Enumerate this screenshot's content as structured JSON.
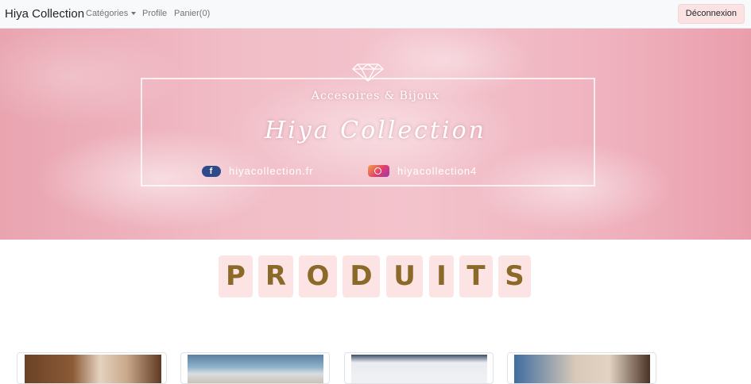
{
  "navbar": {
    "brand": "Hiya Collection",
    "categories_label": "Catégories",
    "profile_label": "Profile",
    "cart_label": "Panier(0)",
    "logout_label": "Déconnexion"
  },
  "banner": {
    "tagline": "Accesoires & Bijoux",
    "title": "Hiya Collection",
    "facebook_handle": "hiyacollection.fr",
    "instagram_handle": "hiyacollection4"
  },
  "produits": {
    "letters": [
      "P",
      "R",
      "O",
      "D",
      "U",
      "I",
      "T",
      "S"
    ]
  },
  "colors": {
    "banner_pink": "#efb3bf",
    "tile_bg": "#fde4e4",
    "tile_text": "#8b6a29",
    "logout_bg": "#fbe3e3"
  },
  "icons": {
    "banner_ornament": "diamond-icon",
    "facebook": "facebook-icon",
    "instagram": "instagram-icon",
    "dropdown": "caret-down-icon"
  }
}
